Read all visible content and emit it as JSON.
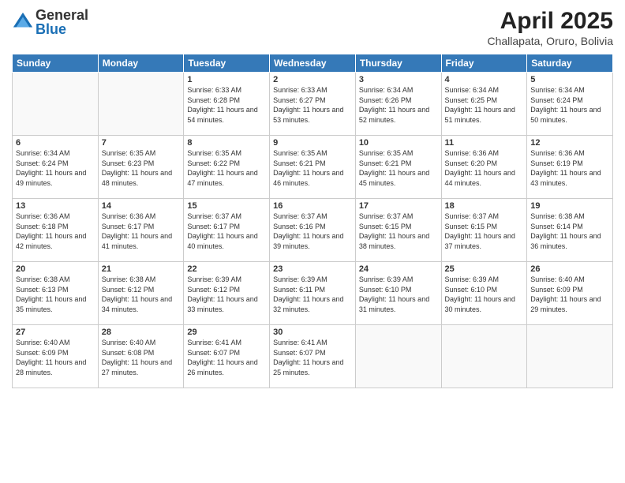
{
  "logo": {
    "general": "General",
    "blue": "Blue"
  },
  "title": "April 2025",
  "location": "Challapata, Oruro, Bolivia",
  "headers": [
    "Sunday",
    "Monday",
    "Tuesday",
    "Wednesday",
    "Thursday",
    "Friday",
    "Saturday"
  ],
  "weeks": [
    [
      {
        "day": "",
        "sunrise": "",
        "sunset": "",
        "daylight": ""
      },
      {
        "day": "",
        "sunrise": "",
        "sunset": "",
        "daylight": ""
      },
      {
        "day": "1",
        "sunrise": "Sunrise: 6:33 AM",
        "sunset": "Sunset: 6:28 PM",
        "daylight": "Daylight: 11 hours and 54 minutes."
      },
      {
        "day": "2",
        "sunrise": "Sunrise: 6:33 AM",
        "sunset": "Sunset: 6:27 PM",
        "daylight": "Daylight: 11 hours and 53 minutes."
      },
      {
        "day": "3",
        "sunrise": "Sunrise: 6:34 AM",
        "sunset": "Sunset: 6:26 PM",
        "daylight": "Daylight: 11 hours and 52 minutes."
      },
      {
        "day": "4",
        "sunrise": "Sunrise: 6:34 AM",
        "sunset": "Sunset: 6:25 PM",
        "daylight": "Daylight: 11 hours and 51 minutes."
      },
      {
        "day": "5",
        "sunrise": "Sunrise: 6:34 AM",
        "sunset": "Sunset: 6:24 PM",
        "daylight": "Daylight: 11 hours and 50 minutes."
      }
    ],
    [
      {
        "day": "6",
        "sunrise": "Sunrise: 6:34 AM",
        "sunset": "Sunset: 6:24 PM",
        "daylight": "Daylight: 11 hours and 49 minutes."
      },
      {
        "day": "7",
        "sunrise": "Sunrise: 6:35 AM",
        "sunset": "Sunset: 6:23 PM",
        "daylight": "Daylight: 11 hours and 48 minutes."
      },
      {
        "day": "8",
        "sunrise": "Sunrise: 6:35 AM",
        "sunset": "Sunset: 6:22 PM",
        "daylight": "Daylight: 11 hours and 47 minutes."
      },
      {
        "day": "9",
        "sunrise": "Sunrise: 6:35 AM",
        "sunset": "Sunset: 6:21 PM",
        "daylight": "Daylight: 11 hours and 46 minutes."
      },
      {
        "day": "10",
        "sunrise": "Sunrise: 6:35 AM",
        "sunset": "Sunset: 6:21 PM",
        "daylight": "Daylight: 11 hours and 45 minutes."
      },
      {
        "day": "11",
        "sunrise": "Sunrise: 6:36 AM",
        "sunset": "Sunset: 6:20 PM",
        "daylight": "Daylight: 11 hours and 44 minutes."
      },
      {
        "day": "12",
        "sunrise": "Sunrise: 6:36 AM",
        "sunset": "Sunset: 6:19 PM",
        "daylight": "Daylight: 11 hours and 43 minutes."
      }
    ],
    [
      {
        "day": "13",
        "sunrise": "Sunrise: 6:36 AM",
        "sunset": "Sunset: 6:18 PM",
        "daylight": "Daylight: 11 hours and 42 minutes."
      },
      {
        "day": "14",
        "sunrise": "Sunrise: 6:36 AM",
        "sunset": "Sunset: 6:17 PM",
        "daylight": "Daylight: 11 hours and 41 minutes."
      },
      {
        "day": "15",
        "sunrise": "Sunrise: 6:37 AM",
        "sunset": "Sunset: 6:17 PM",
        "daylight": "Daylight: 11 hours and 40 minutes."
      },
      {
        "day": "16",
        "sunrise": "Sunrise: 6:37 AM",
        "sunset": "Sunset: 6:16 PM",
        "daylight": "Daylight: 11 hours and 39 minutes."
      },
      {
        "day": "17",
        "sunrise": "Sunrise: 6:37 AM",
        "sunset": "Sunset: 6:15 PM",
        "daylight": "Daylight: 11 hours and 38 minutes."
      },
      {
        "day": "18",
        "sunrise": "Sunrise: 6:37 AM",
        "sunset": "Sunset: 6:15 PM",
        "daylight": "Daylight: 11 hours and 37 minutes."
      },
      {
        "day": "19",
        "sunrise": "Sunrise: 6:38 AM",
        "sunset": "Sunset: 6:14 PM",
        "daylight": "Daylight: 11 hours and 36 minutes."
      }
    ],
    [
      {
        "day": "20",
        "sunrise": "Sunrise: 6:38 AM",
        "sunset": "Sunset: 6:13 PM",
        "daylight": "Daylight: 11 hours and 35 minutes."
      },
      {
        "day": "21",
        "sunrise": "Sunrise: 6:38 AM",
        "sunset": "Sunset: 6:12 PM",
        "daylight": "Daylight: 11 hours and 34 minutes."
      },
      {
        "day": "22",
        "sunrise": "Sunrise: 6:39 AM",
        "sunset": "Sunset: 6:12 PM",
        "daylight": "Daylight: 11 hours and 33 minutes."
      },
      {
        "day": "23",
        "sunrise": "Sunrise: 6:39 AM",
        "sunset": "Sunset: 6:11 PM",
        "daylight": "Daylight: 11 hours and 32 minutes."
      },
      {
        "day": "24",
        "sunrise": "Sunrise: 6:39 AM",
        "sunset": "Sunset: 6:10 PM",
        "daylight": "Daylight: 11 hours and 31 minutes."
      },
      {
        "day": "25",
        "sunrise": "Sunrise: 6:39 AM",
        "sunset": "Sunset: 6:10 PM",
        "daylight": "Daylight: 11 hours and 30 minutes."
      },
      {
        "day": "26",
        "sunrise": "Sunrise: 6:40 AM",
        "sunset": "Sunset: 6:09 PM",
        "daylight": "Daylight: 11 hours and 29 minutes."
      }
    ],
    [
      {
        "day": "27",
        "sunrise": "Sunrise: 6:40 AM",
        "sunset": "Sunset: 6:09 PM",
        "daylight": "Daylight: 11 hours and 28 minutes."
      },
      {
        "day": "28",
        "sunrise": "Sunrise: 6:40 AM",
        "sunset": "Sunset: 6:08 PM",
        "daylight": "Daylight: 11 hours and 27 minutes."
      },
      {
        "day": "29",
        "sunrise": "Sunrise: 6:41 AM",
        "sunset": "Sunset: 6:07 PM",
        "daylight": "Daylight: 11 hours and 26 minutes."
      },
      {
        "day": "30",
        "sunrise": "Sunrise: 6:41 AM",
        "sunset": "Sunset: 6:07 PM",
        "daylight": "Daylight: 11 hours and 25 minutes."
      },
      {
        "day": "",
        "sunrise": "",
        "sunset": "",
        "daylight": ""
      },
      {
        "day": "",
        "sunrise": "",
        "sunset": "",
        "daylight": ""
      },
      {
        "day": "",
        "sunrise": "",
        "sunset": "",
        "daylight": ""
      }
    ]
  ]
}
